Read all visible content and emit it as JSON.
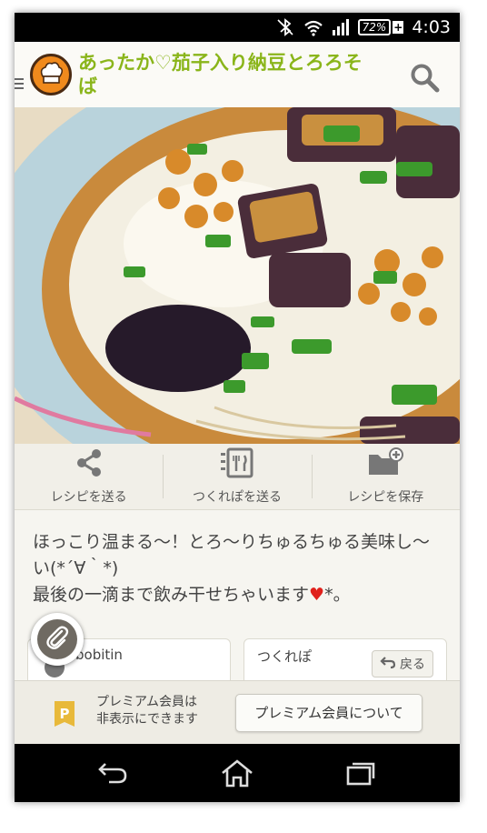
{
  "status_bar": {
    "battery": "72%",
    "time": "4:03"
  },
  "app_bar": {
    "title": "あったか♡茄子入り納豆とろろそば",
    "icons": [
      "menu-icon",
      "cookpad-chef-logo",
      "search-icon"
    ]
  },
  "actions": [
    {
      "label": "レシピを送る",
      "icon": "share-icon"
    },
    {
      "label": "つくれぽを送る",
      "icon": "report-icon"
    },
    {
      "label": "レシピを保存",
      "icon": "save-folder-icon"
    }
  ],
  "description": {
    "line1": "ほっこり温まる〜！とろ〜りちゅるちゅる美味し〜い(*´∀｀*)",
    "line2a": "最後の一滴まで飲み干せちゃいます",
    "heart": "♥",
    "line2b": "*。"
  },
  "cards": {
    "author": "bobitin",
    "tsukurepo": "つくれぽ"
  },
  "back_button": {
    "label": "戻る"
  },
  "ad_bar": {
    "text_line1": "プレミアム会員は",
    "text_line2": "非表示にできます",
    "button_label": "プレミアム会員について",
    "icon_letter": "P"
  },
  "colors": {
    "title_green": "#8ab51a",
    "logo_orange": "#f08a1d",
    "heart_red": "#e0201b",
    "premium_gold": "#e8b93a"
  }
}
